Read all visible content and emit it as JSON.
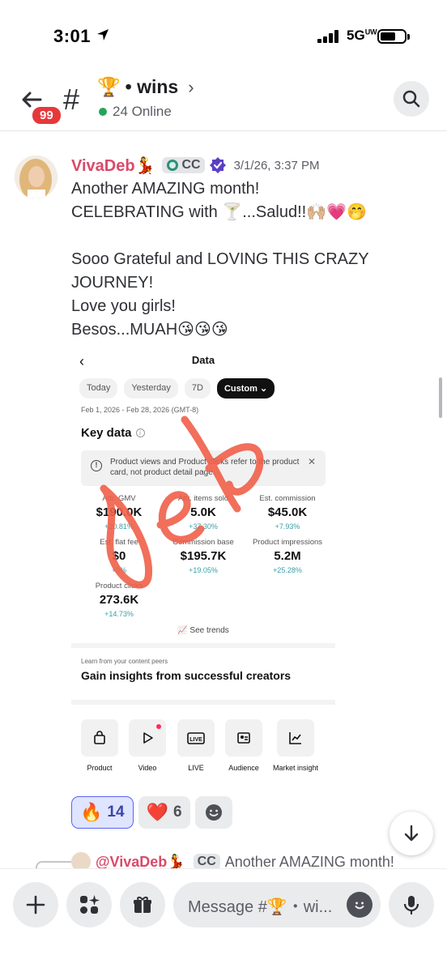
{
  "status_bar": {
    "time": "3:01",
    "network": "5G",
    "network_suffix": "UW"
  },
  "header": {
    "unread_badge": "99",
    "channel_emoji": "🏆",
    "channel_name": "• wins",
    "chevron": "›",
    "online_text": "24 Online"
  },
  "message": {
    "author": "VivaDeb💃",
    "tag": "CC",
    "timestamp": "3/1/26, 3:37 PM",
    "text": "Another AMAZING month!\nCELEBRATING with 🍸...Salud!!🙌🏼💗🤭\n\nSooo Grateful and LOVING THIS CRAZY JOURNEY!\nLove you girls!\nBesos...MUAH😘😘😘"
  },
  "screenshot": {
    "title": "Data",
    "tabs": [
      "Today",
      "Yesterday",
      "7D",
      "Custom ⌄"
    ],
    "active_tab": "Custom ⌄",
    "date_range": "Feb 1, 2026 - Feb 28, 2026 (GMT-8)",
    "key_data_title": "Key data",
    "notice": "Product views and Product clicks refer to the product card, not product detail page.",
    "metrics": [
      {
        "label": "Attr. GMV",
        "value": "$190.0K",
        "change": "+20.81%"
      },
      {
        "label": "Attr. items sold",
        "value": "5.0K",
        "change": "+37.30%"
      },
      {
        "label": "Est. commission",
        "value": "$45.0K",
        "change": "+7.93%"
      },
      {
        "label": "Est. flat fee",
        "value": "$0",
        "change": "+0%"
      },
      {
        "label": "Commission base",
        "value": "$195.7K",
        "change": "+19.05%"
      },
      {
        "label": "Product impressions",
        "value": "5.2M",
        "change": "+25.28%"
      },
      {
        "label": "Product clicks",
        "value": "273.6K",
        "change": "+14.73%"
      }
    ],
    "see_trends": "See trends",
    "peers_small": "Learn from your content peers",
    "peers_title": "Gain insights from successful creators",
    "tools": [
      "Product",
      "Video",
      "LIVE",
      "Audience",
      "Market insight"
    ],
    "overlay_handwriting": "Deb"
  },
  "reactions": [
    {
      "emoji": "🔥",
      "count": "14"
    },
    {
      "emoji": "❤️",
      "count": "6"
    }
  ],
  "next_message": {
    "mention": "@VivaDeb💃",
    "tag": "CC",
    "preview": "Another AMAZING month!"
  },
  "composer": {
    "placeholder": "Message #🏆・wi..."
  },
  "colors": {
    "author": "#d94a6b",
    "online": "#23a55a",
    "badge": "#e5383b",
    "accent": "#5865f2"
  }
}
